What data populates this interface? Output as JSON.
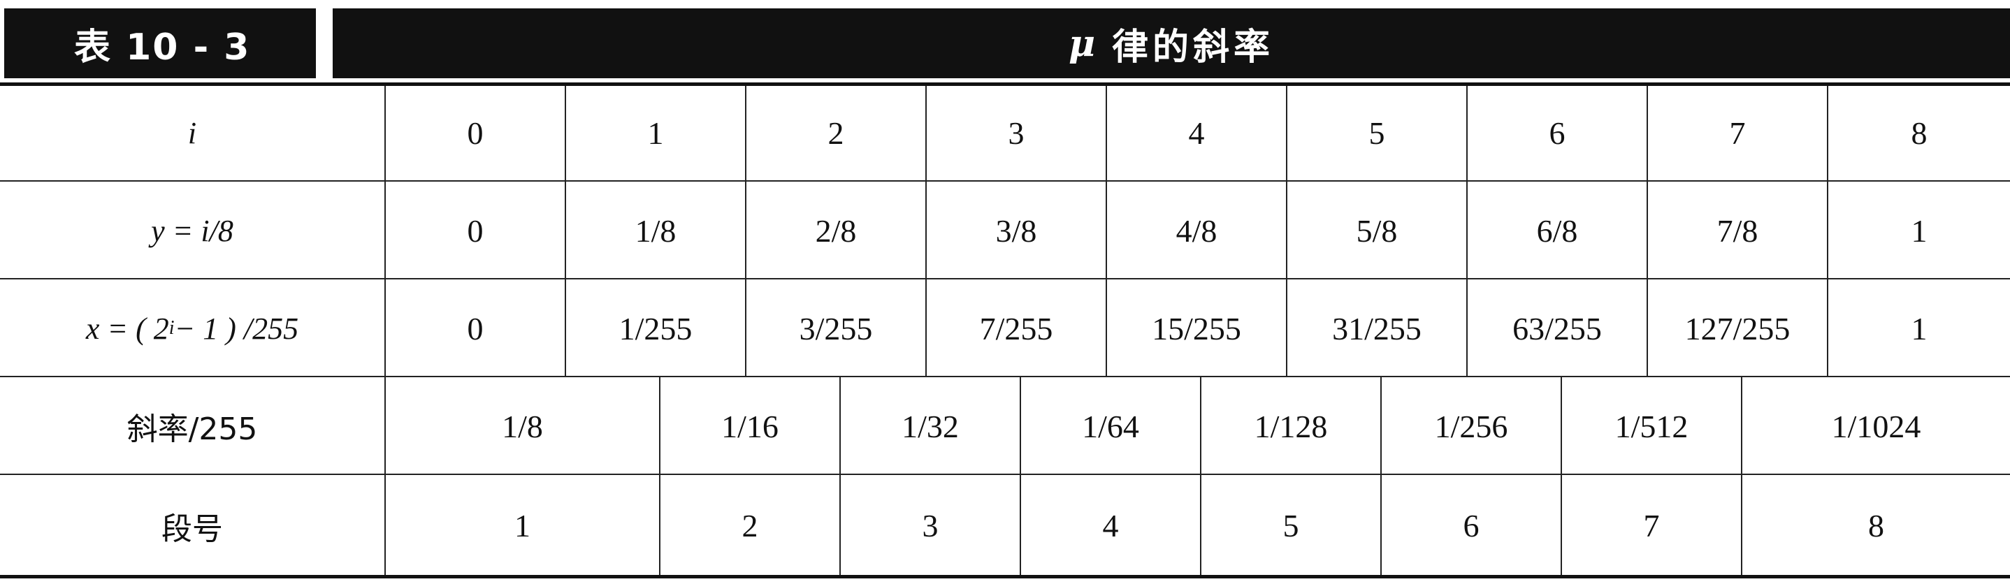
{
  "title": {
    "table_number": "表 10 - 3",
    "caption_symbol": "μ",
    "caption_text": "律的斜率"
  },
  "rows": {
    "i": {
      "header": "i",
      "values": [
        "0",
        "1",
        "2",
        "3",
        "4",
        "5",
        "6",
        "7",
        "8"
      ]
    },
    "y": {
      "header": "y = i/8",
      "values": [
        "0",
        "1/8",
        "2/8",
        "3/8",
        "4/8",
        "5/8",
        "6/8",
        "7/8",
        "1"
      ]
    },
    "x": {
      "header_prefix": "x = ( 2",
      "header_sup": "i",
      "header_suffix": " − 1 ) /255",
      "values": [
        "0",
        "1/255",
        "3/255",
        "7/255",
        "15/255",
        "31/255",
        "63/255",
        "127/255",
        "1"
      ]
    },
    "slope": {
      "header": "斜率/255",
      "values": [
        "1/8",
        "1/16",
        "1/32",
        "1/64",
        "1/128",
        "1/256",
        "1/512",
        "1/1024"
      ]
    },
    "segment": {
      "header": "段号",
      "values": [
        "1",
        "2",
        "3",
        "4",
        "5",
        "6",
        "7",
        "8"
      ]
    }
  }
}
